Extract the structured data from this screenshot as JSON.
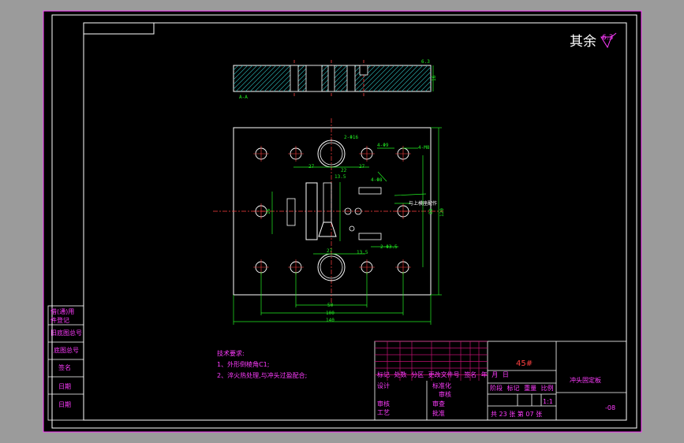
{
  "drawing": {
    "roughness_note": "其余",
    "roughness_value": "6.3",
    "top_view_roughness": "6.3",
    "section_label": "A-A",
    "dims": {
      "width_50": "50",
      "width_100": "100",
      "width_140": "140",
      "height_120": "120",
      "height_80": "80",
      "dim_27a": "27",
      "dim_27b": "27",
      "dim_22": "22",
      "dim_13_5": "13.5",
      "dim_13_5b": "13.5",
      "dim_16": "16",
      "dim_thk": "16",
      "hole1": "2-Φ16",
      "hole2": "4-Φ9",
      "hole3": "4-M8",
      "hole4": "4-Φ8",
      "hole5": "2-Φ3.5"
    },
    "note_hole": "与上模座配作"
  },
  "tech_req": {
    "title": "技术要求:",
    "line1": "1、外形倒棱角C1;",
    "line2": "2、淬火热处理,与冲头过盈配合;"
  },
  "side_labels": [
    "借(通)用",
    "件登记",
    "旧底图总号",
    "底图总号",
    "签名",
    "日期",
    "日期"
  ],
  "title_block": {
    "material": "45#",
    "part_name": "冲头固定板",
    "drawing_no": "-08",
    "scale": "1:1",
    "sheet_info": "共 23 张  第 07 张",
    "headers_row": [
      "标记",
      "处数",
      "分区",
      "更改文件号",
      "签名",
      "年",
      "月",
      "日"
    ],
    "design": "设计",
    "standardization": "标准化",
    "review": "审核",
    "process": "工艺",
    "approve": "批准",
    "stage_headers": [
      "阶段",
      "标记",
      "重量",
      "比例"
    ],
    "rows_mid": [
      "审核",
      "审查"
    ]
  }
}
